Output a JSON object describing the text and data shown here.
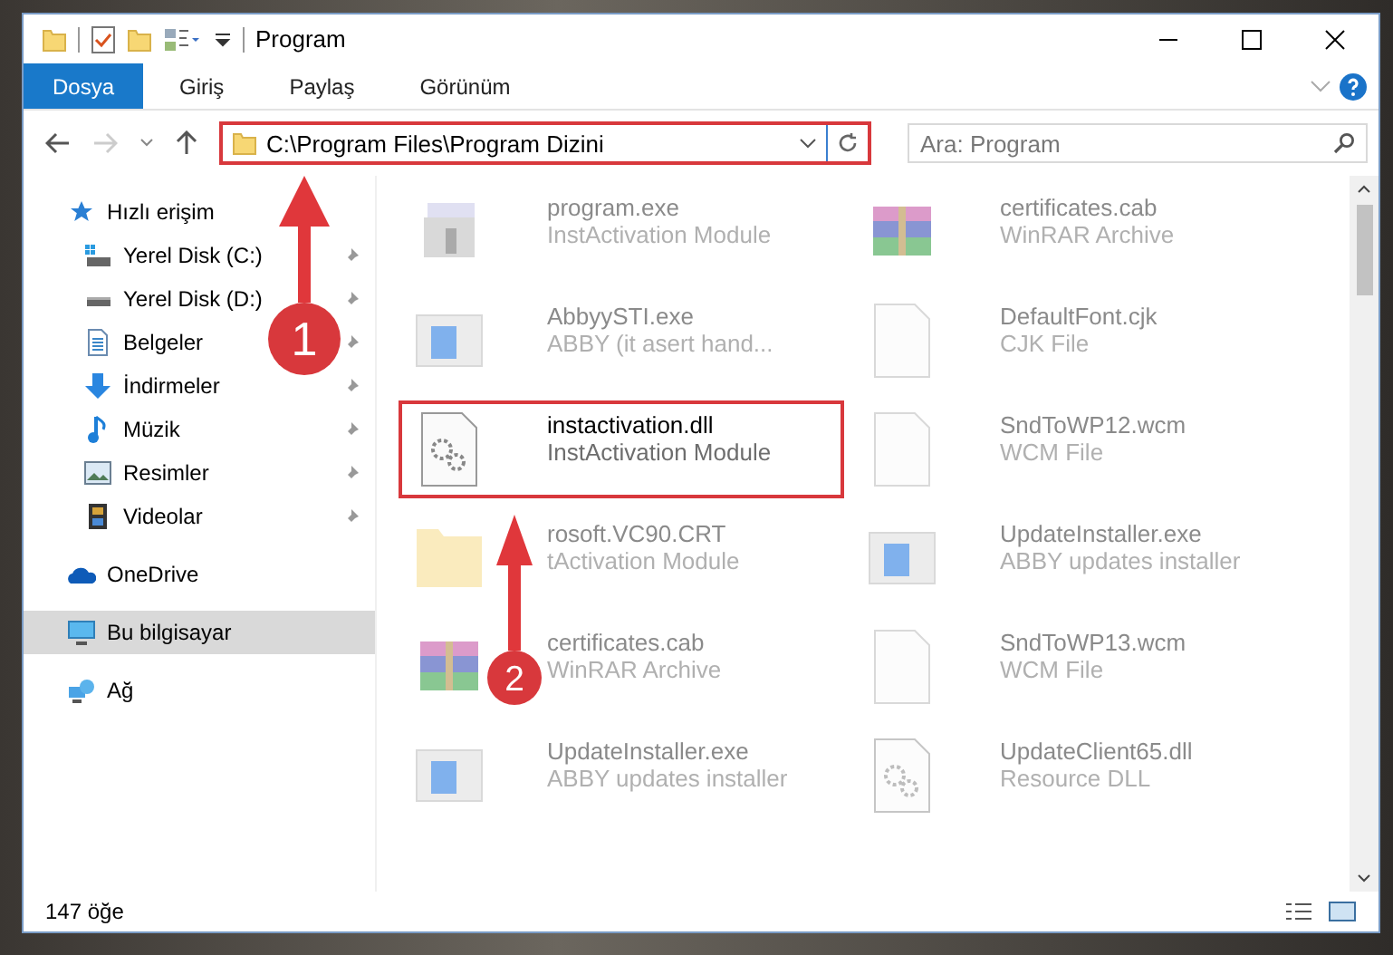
{
  "window": {
    "title": "Program"
  },
  "ribbon_tabs": [
    {
      "label": "Dosya",
      "selected": true
    },
    {
      "label": "Giriş",
      "selected": false
    },
    {
      "label": "Paylaş",
      "selected": false
    },
    {
      "label": "Görünüm",
      "selected": false
    }
  ],
  "address_bar": {
    "path": "C:\\Program Files\\Program Dizini",
    "highlighted": true
  },
  "search": {
    "placeholder": "Ara: Program"
  },
  "sidebar": {
    "items": [
      {
        "label": "Hızlı erişim",
        "selected": false,
        "children": [
          {
            "label": "Yerel Disk (C:)",
            "pinned": true,
            "selected": false
          },
          {
            "label": "Yerel Disk (D:)",
            "pinned": true,
            "selected": false
          },
          {
            "label": "Belgeler",
            "pinned": true,
            "selected": false
          },
          {
            "label": "İndirmeler",
            "pinned": true,
            "selected": false
          },
          {
            "label": "Müzik",
            "pinned": true,
            "selected": false
          },
          {
            "label": "Resimler",
            "pinned": true,
            "selected": false
          },
          {
            "label": "Videolar",
            "pinned": true,
            "selected": false
          }
        ]
      },
      {
        "label": "OneDrive",
        "selected": false
      },
      {
        "label": "Bu bilgisayar",
        "selected": true
      },
      {
        "label": "Ağ",
        "selected": false
      }
    ]
  },
  "files": [
    {
      "name": "program.exe",
      "type": "InstActivation Module",
      "kind": "installer",
      "faded": true,
      "highlighted": false
    },
    {
      "name": "certificates.cab",
      "type": "WinRAR Archive",
      "kind": "archive",
      "faded": true,
      "highlighted": false
    },
    {
      "name": "AbbyySTI.exe",
      "type": "ABBY (it asert hand...",
      "kind": "app",
      "faded": true,
      "highlighted": false
    },
    {
      "name": "DefaultFont.cjk",
      "type": "CJK File",
      "kind": "blank",
      "faded": true,
      "highlighted": false
    },
    {
      "name": "instactivation.dll",
      "type": "InstActivation Module",
      "kind": "gears",
      "faded": false,
      "highlighted": true
    },
    {
      "name": "SndToWP12.wcm",
      "type": "WCM File",
      "kind": "blank",
      "faded": true,
      "highlighted": false
    },
    {
      "name": "rosoft.VC90.CRT",
      "type": "tActivation Module",
      "kind": "folder",
      "faded": true,
      "highlighted": false
    },
    {
      "name": "UpdateInstaller.exe",
      "type": "ABBY updates installer",
      "kind": "app",
      "faded": true,
      "highlighted": false
    },
    {
      "name": "certificates.cab",
      "type": "WinRAR Archive",
      "kind": "archive",
      "faded": true,
      "highlighted": false
    },
    {
      "name": "SndToWP13.wcm",
      "type": "WCM File",
      "kind": "blank",
      "faded": true,
      "highlighted": false
    },
    {
      "name": "UpdateInstaller.exe",
      "type": "ABBY updates installer",
      "kind": "app",
      "faded": true,
      "highlighted": false
    },
    {
      "name": "UpdateClient65.dll",
      "type": "Resource DLL",
      "kind": "gears",
      "faded": true,
      "highlighted": false
    }
  ],
  "callouts": [
    {
      "label": "1"
    },
    {
      "label": "2"
    }
  ],
  "status_bar": {
    "count": "147 öğe"
  }
}
